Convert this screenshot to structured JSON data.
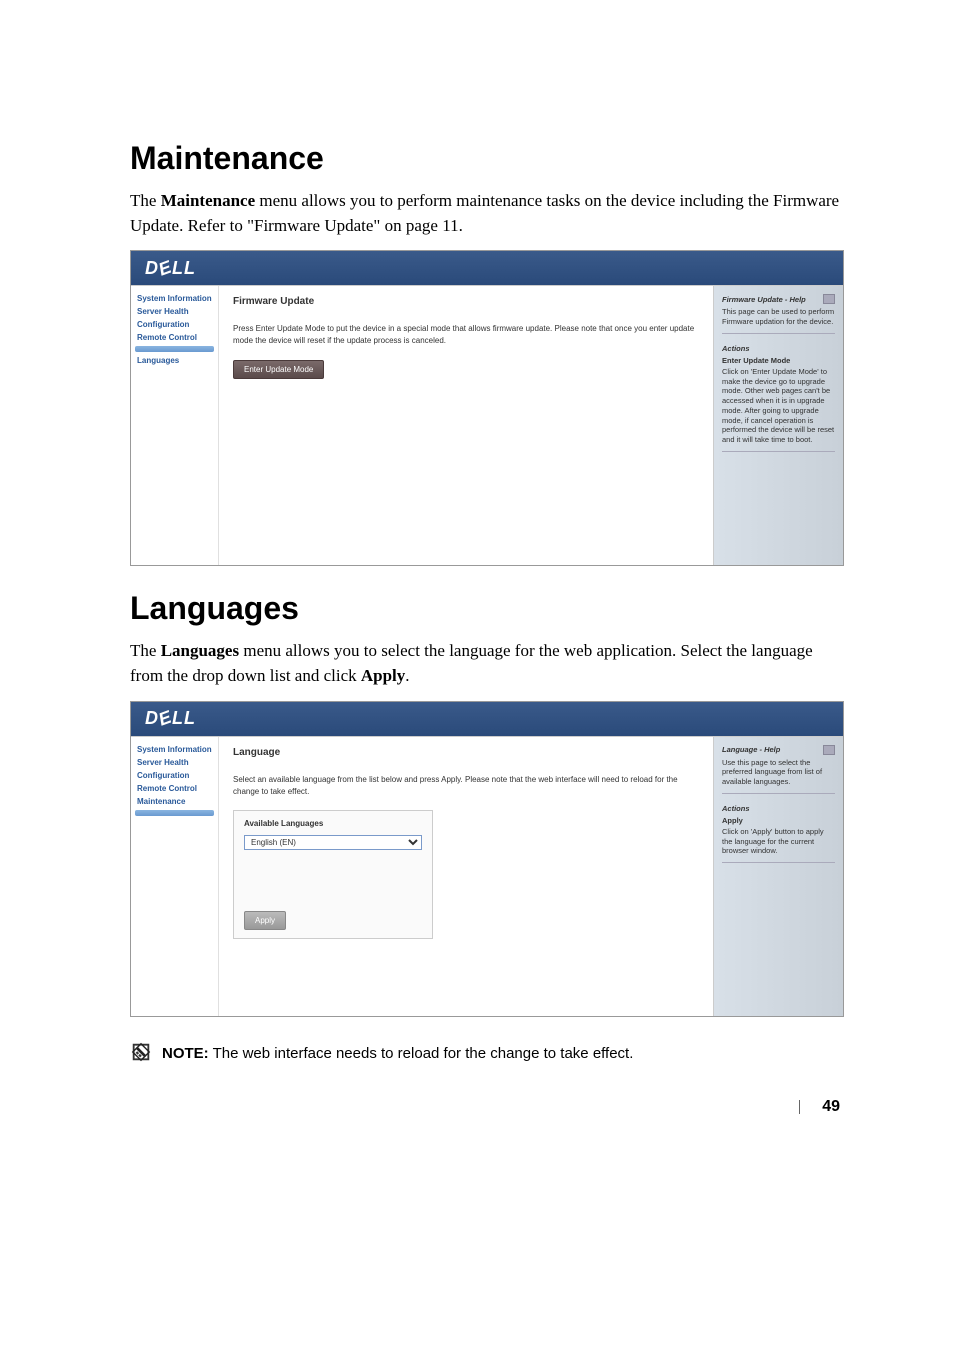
{
  "page": {
    "number": "49"
  },
  "section1": {
    "heading": "Maintenance",
    "para_prefix": "The ",
    "para_bold1": "Maintenance",
    "para_suffix": " menu allows you to perform maintenance tasks on the device including the Firmware Update. Refer to \"Firmware Update\" on page 11."
  },
  "screenshot1": {
    "logo": "DELL",
    "sidebar": {
      "items": [
        "System Information",
        "Server Health",
        "Configuration",
        "Remote Control"
      ],
      "active_after": "",
      "last": "Languages"
    },
    "main": {
      "title": "Firmware Update",
      "text": "Press Enter Update Mode to put the device in a special mode that allows firmware update. Please note that once you enter update mode the device will reset if the update process is canceled.",
      "button": "Enter Update Mode"
    },
    "right": {
      "title": "Firmware Update - Help",
      "desc": "This page can be used to perform Firmware updation for the device.",
      "actions_label": "Actions",
      "action_name": "Enter Update Mode",
      "action_desc": "Click on 'Enter Update Mode' to make the device go to upgrade mode. Other web pages can't be accessed when it is in upgrade mode. After going to upgrade mode, if cancel operation is performed the device will be reset and it will take time to boot."
    }
  },
  "section2": {
    "heading": "Languages",
    "para_prefix": "The ",
    "para_bold1": "Languages",
    "para_mid": " menu allows you to select the language for the web application. Select the language from the drop down list and click ",
    "para_bold2": "Apply",
    "para_suffix": "."
  },
  "screenshot2": {
    "logo": "DELL",
    "sidebar": {
      "items": [
        "System Information",
        "Server Health",
        "Configuration",
        "Remote Control",
        "Maintenance"
      ],
      "active_after": ""
    },
    "main": {
      "title": "Language",
      "text": "Select an available language from the list below and press Apply. Please note that the web interface will need to reload for the change to take effect.",
      "lang_label": "Available Languages",
      "lang_value": "English (EN)",
      "apply": "Apply"
    },
    "right": {
      "title": "Language - Help",
      "desc": "Use this page to select the preferred language from list of available languages.",
      "actions_label": "Actions",
      "action_name": "Apply",
      "action_desc": "Click on 'Apply' button to apply the language for the current browser window."
    }
  },
  "note": {
    "label": "NOTE:",
    "text": " The web interface needs to reload for the change to take effect."
  }
}
